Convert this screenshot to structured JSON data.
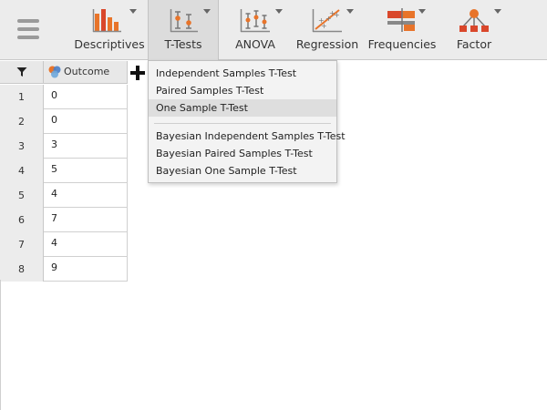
{
  "toolbar": {
    "tools": [
      {
        "id": "descriptives",
        "label": "Descriptives",
        "icon": "bar-chart-icon"
      },
      {
        "id": "ttests",
        "label": "T-Tests",
        "icon": "t-test-icon",
        "active": true
      },
      {
        "id": "anova",
        "label": "ANOVA",
        "icon": "anova-icon"
      },
      {
        "id": "regression",
        "label": "Regression",
        "icon": "regression-icon"
      },
      {
        "id": "frequencies",
        "label": "Frequencies",
        "icon": "frequencies-icon"
      },
      {
        "id": "factor",
        "label": "Factor",
        "icon": "factor-icon"
      }
    ]
  },
  "spreadsheet": {
    "column_header": "Outcome",
    "rows": [
      {
        "num": "1",
        "value": "0"
      },
      {
        "num": "2",
        "value": "0"
      },
      {
        "num": "3",
        "value": "3"
      },
      {
        "num": "4",
        "value": "5"
      },
      {
        "num": "5",
        "value": "4"
      },
      {
        "num": "6",
        "value": "7"
      },
      {
        "num": "7",
        "value": "4"
      },
      {
        "num": "8",
        "value": "9"
      }
    ]
  },
  "ttest_menu": {
    "items": [
      {
        "label": "Independent Samples T-Test"
      },
      {
        "label": "Paired Samples T-Test"
      },
      {
        "label": "One Sample T-Test",
        "highlighted": true
      }
    ],
    "bayesian_items": [
      {
        "label": "Bayesian Independent Samples T-Test"
      },
      {
        "label": "Bayesian Paired Samples T-Test"
      },
      {
        "label": "Bayesian One Sample T-Test"
      }
    ]
  },
  "colors": {
    "accent_orange": "#e8742a",
    "accent_red": "#d9472b",
    "icon_gray": "#8a8a8a",
    "toolbar_bg": "#ececec",
    "highlight_bg": "#dedede"
  }
}
